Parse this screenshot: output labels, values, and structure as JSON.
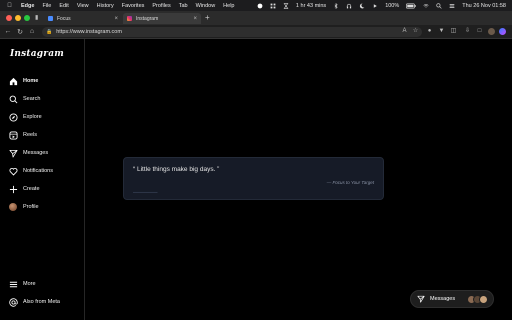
{
  "menubar": {
    "app_name": "Edge",
    "items": [
      "File",
      "Edit",
      "View",
      "History",
      "Favorites",
      "Profiles",
      "Tab",
      "Window",
      "Help"
    ],
    "timer": "1 hr 43 mins",
    "battery": "100%",
    "datetime": "Thu 26 Nov 01:58"
  },
  "tabs": [
    {
      "label": "Focus",
      "active": false
    },
    {
      "label": "Instagram",
      "active": true
    }
  ],
  "address": {
    "url": "https://www.instagram.com"
  },
  "sidebar": {
    "logo": "Instagram",
    "items": [
      {
        "label": "Home",
        "icon": "home-icon",
        "active": true
      },
      {
        "label": "Search",
        "icon": "search-icon",
        "active": false
      },
      {
        "label": "Explore",
        "icon": "compass-icon",
        "active": false
      },
      {
        "label": "Reels",
        "icon": "reels-icon",
        "active": false
      },
      {
        "label": "Messages",
        "icon": "paper-plane-icon",
        "active": false
      },
      {
        "label": "Notifications",
        "icon": "heart-icon",
        "active": false
      },
      {
        "label": "Create",
        "icon": "plus-icon",
        "active": false
      },
      {
        "label": "Profile",
        "icon": "avatar",
        "active": false
      }
    ],
    "bottom_items": [
      {
        "label": "More",
        "icon": "menu-icon"
      },
      {
        "label": "Also from Meta",
        "icon": "at-icon"
      }
    ]
  },
  "card": {
    "quote": "“ Little things make big days. ”",
    "attribution": "— Focus to Your Target"
  },
  "messages_pill": {
    "label": "Messages"
  },
  "colors": {
    "background": "#000000",
    "card": "#161b27",
    "close": "#ff5f57",
    "minimize": "#febc2e",
    "maximize": "#28c840"
  }
}
